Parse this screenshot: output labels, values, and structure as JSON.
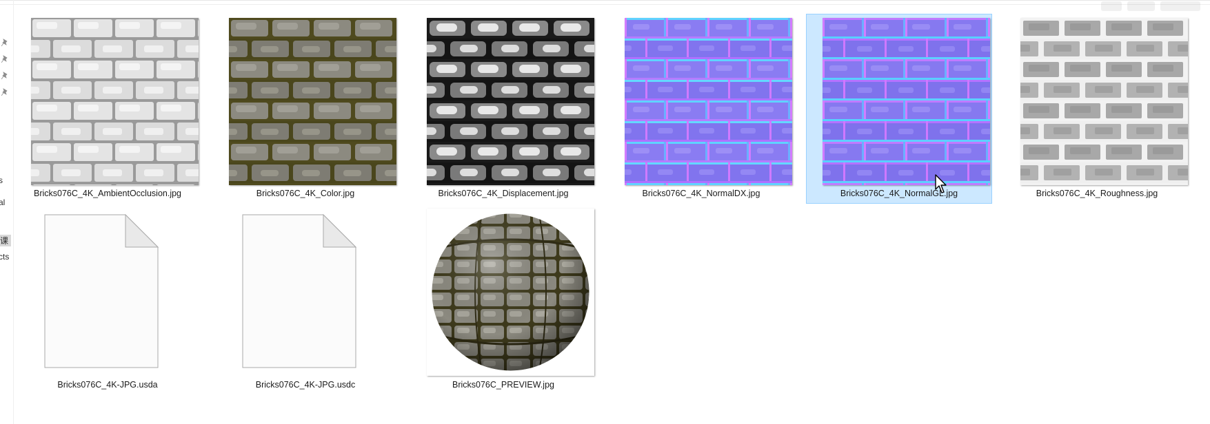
{
  "nav_fragments": [
    "s",
    "al",
    "课",
    "cts"
  ],
  "files": [
    {
      "name": "Bricks076C_4K_AmbientOcclusion.jpg",
      "kind": "ambient-occlusion"
    },
    {
      "name": "Bricks076C_4K_Color.jpg",
      "kind": "color"
    },
    {
      "name": "Bricks076C_4K_Displacement.jpg",
      "kind": "displacement"
    },
    {
      "name": "Bricks076C_4K_NormalDX.jpg",
      "kind": "normal-dx"
    },
    {
      "name": "Bricks076C_4K_NormalGL.jpg",
      "kind": "normal-gl",
      "selected": true
    },
    {
      "name": "Bricks076C_4K_Roughness.jpg",
      "kind": "roughness"
    },
    {
      "name": "Bricks076C_4K-JPG.usda",
      "kind": "generic-file"
    },
    {
      "name": "Bricks076C_4K-JPG.usdc",
      "kind": "generic-file"
    },
    {
      "name": "Bricks076C_PREVIEW.jpg",
      "kind": "sphere-preview"
    }
  ],
  "colors": {
    "selection_bg": "#cce8ff",
    "selection_border": "#99d1ff",
    "ao_mortar": "#9a9a9a",
    "ao_brick": "#e4e4e4",
    "color_mortar": "#4f4a1e",
    "color_brick": "#8c8a80",
    "disp_mortar": "#1a1a1a",
    "disp_brick": "#b8b8b8",
    "normal_base": "#8a7cf2",
    "normal_edge": "#5fd3ff",
    "rough_mortar": "#f2f2f2",
    "rough_brick": "#a8a8a8"
  },
  "icons": [
    "pin-icon",
    "generic-file-icon",
    "mouse-cursor-icon",
    "watermark-logo"
  ]
}
